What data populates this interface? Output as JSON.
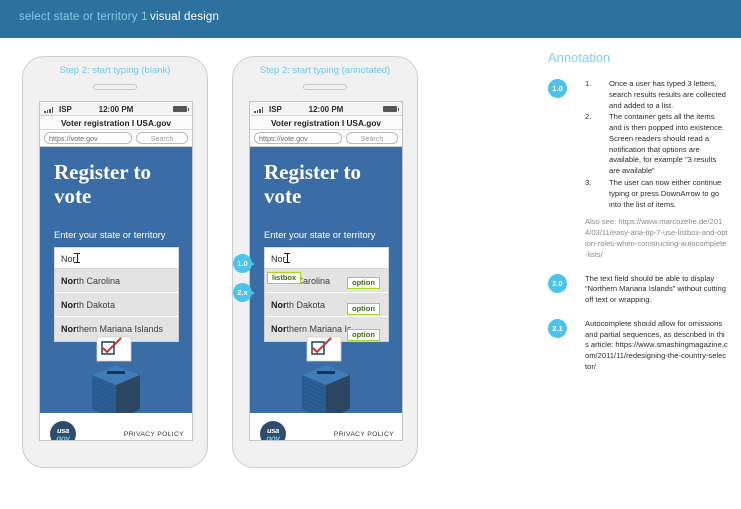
{
  "header": {
    "breadcrumb_active": "select state or territory 1",
    "breadcrumb_section": "visual design"
  },
  "phones": [
    {
      "step_label": "Step 2: start typing (blank)",
      "status": {
        "carrier": "ISP",
        "time": "12:00 PM"
      },
      "browser": {
        "page_title": "Voter registration I USA.gov",
        "url_value": "https://vote.gov",
        "search_placeholder": "Search"
      },
      "page": {
        "hero": "Register to vote",
        "prompt": "Enter your state or territory",
        "input_value": "Nor",
        "options": [
          {
            "match": "Nor",
            "rest": "th Carolina"
          },
          {
            "match": "Nor",
            "rest": "th Dakota"
          },
          {
            "match": "Nor",
            "rest": "thern Mariana Islands"
          }
        ],
        "privacy": "PRIVACY POLICY",
        "logo_line1": "usa",
        "logo_line2": "gov"
      }
    },
    {
      "step_label": "Step 2: start typing (annotated)",
      "status": {
        "carrier": "ISP",
        "time": "12:00 PM"
      },
      "browser": {
        "page_title": "Voter registration I USA.gov",
        "url_value": "https://vote.gov",
        "search_placeholder": "Search"
      },
      "page": {
        "hero": "Register to vote",
        "prompt": "Enter your state or territory",
        "input_value": "Nor",
        "options": [
          {
            "match": "Nor",
            "rest": "th Carolina"
          },
          {
            "match": "Nor",
            "rest": "th Dakota"
          },
          {
            "match": "Nor",
            "rest": "thern Mariana Is"
          }
        ],
        "privacy": "PRIVACY POLICY",
        "logo_line1": "usa",
        "logo_line2": "gov"
      },
      "markers": [
        {
          "id": "1.0"
        },
        {
          "id": "2.x"
        }
      ],
      "tags": {
        "listbox": "listbox",
        "option": "option"
      }
    }
  ],
  "annotation": {
    "title": "Annotation",
    "items": [
      {
        "badge": "1.0",
        "ordered": [
          {
            "num": "1.",
            "text": "Once a user has typed 3 letters, search results results are collected and added to a list."
          },
          {
            "num": "2.",
            "text": "The container gets all the items and is then popped into existence. Screen readers should read a notification that  options are available, for example \"3 results are available\""
          },
          {
            "num": "3.",
            "text": "The user can now either continue typing or press DownArrow to go into the list of items."
          }
        ],
        "link": "Also see: https://www.marcozehe.de/2014/03/11/easy-aria-tip-7-use-listbox-and-option-roles-when-constructing-autocomplete-lists/"
      },
      {
        "badge": "2.0",
        "text": "The text field should be able to display “Northern Mariana Islands” without cutting off text or wrapping."
      },
      {
        "badge": "2.1",
        "text": "Autocomplete should allow for omissions and partial sequences, as described in this article: https://www.smashingmagazine.com/2011/11/redesigning-the-country-selector/"
      }
    ]
  },
  "colors": {
    "header_bg": "#2d719e",
    "accent_blue": "#4cc3ea",
    "page_blue": "#3a6ca6",
    "tag_border": "#a9d329",
    "tag_text": "#3f6d12"
  }
}
